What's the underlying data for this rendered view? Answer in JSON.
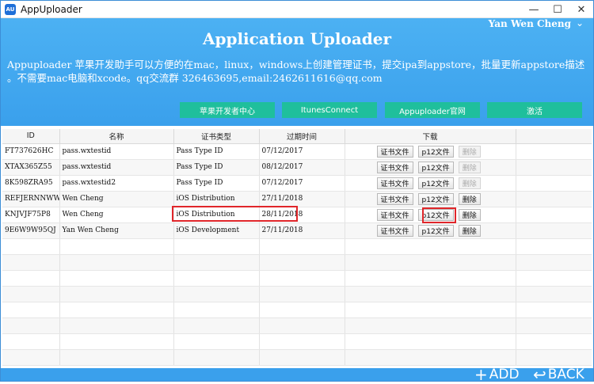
{
  "window": {
    "title": "AppUploader",
    "icon_text": "AU",
    "controls": {
      "minimize": "—",
      "maximize": "☐",
      "close": "✕"
    }
  },
  "header": {
    "user_name": "Yan Wen Cheng",
    "user_menu_icon": "chevron-down-icon",
    "app_title": "Application Uploader",
    "description": "Appuploader 苹果开发助手可以方便的在mac，linux，windows上创建管理证书，提交ipa到appstore，批量更新appstore描述 。不需要mac电脑和xcode。qq交流群 326463695,email:2462611616@qq.com",
    "nav_buttons": [
      "苹果开发者中心",
      "ItunesConnect",
      "Appuploader官网",
      "激活"
    ],
    "nav_color": "#1fbf9c"
  },
  "table": {
    "columns": [
      "ID",
      "名称",
      "证书类型",
      "过期时间",
      "下载"
    ],
    "download_labels": {
      "cert": "证书文件",
      "p12": "p12文件",
      "delete": "删除"
    },
    "rows": [
      {
        "id": "FT737626HC",
        "name": "pass.wxtestid",
        "type": "Pass Type ID",
        "expires": "07/12/2017",
        "delete_enabled": false
      },
      {
        "id": "XTAX365Z55",
        "name": "pass.wxtestid",
        "type": "Pass Type ID",
        "expires": "08/12/2017",
        "delete_enabled": false
      },
      {
        "id": "8K598ZRA95",
        "name": "pass.wxtestid2",
        "type": "Pass Type ID",
        "expires": "07/12/2017",
        "delete_enabled": false
      },
      {
        "id": "REFJERNNWW",
        "name": "Wen Cheng",
        "type": "iOS Distribution",
        "expires": "27/11/2018",
        "delete_enabled": true
      },
      {
        "id": "KNJVJF75P8",
        "name": "Wen Cheng",
        "type": "iOS Distribution",
        "expires": "28/11/2018",
        "delete_enabled": true
      },
      {
        "id": "9E6W9W95QJ",
        "name": "Yan Wen Cheng",
        "type": "iOS Development",
        "expires": "27/11/2018",
        "delete_enabled": true
      }
    ],
    "empty_rows": 8,
    "highlight_color": "#e0262a"
  },
  "footer": {
    "add_label": "ADD",
    "add_icon": "plus-icon",
    "back_label": "BACK",
    "back_icon": "back-arrow-icon"
  }
}
